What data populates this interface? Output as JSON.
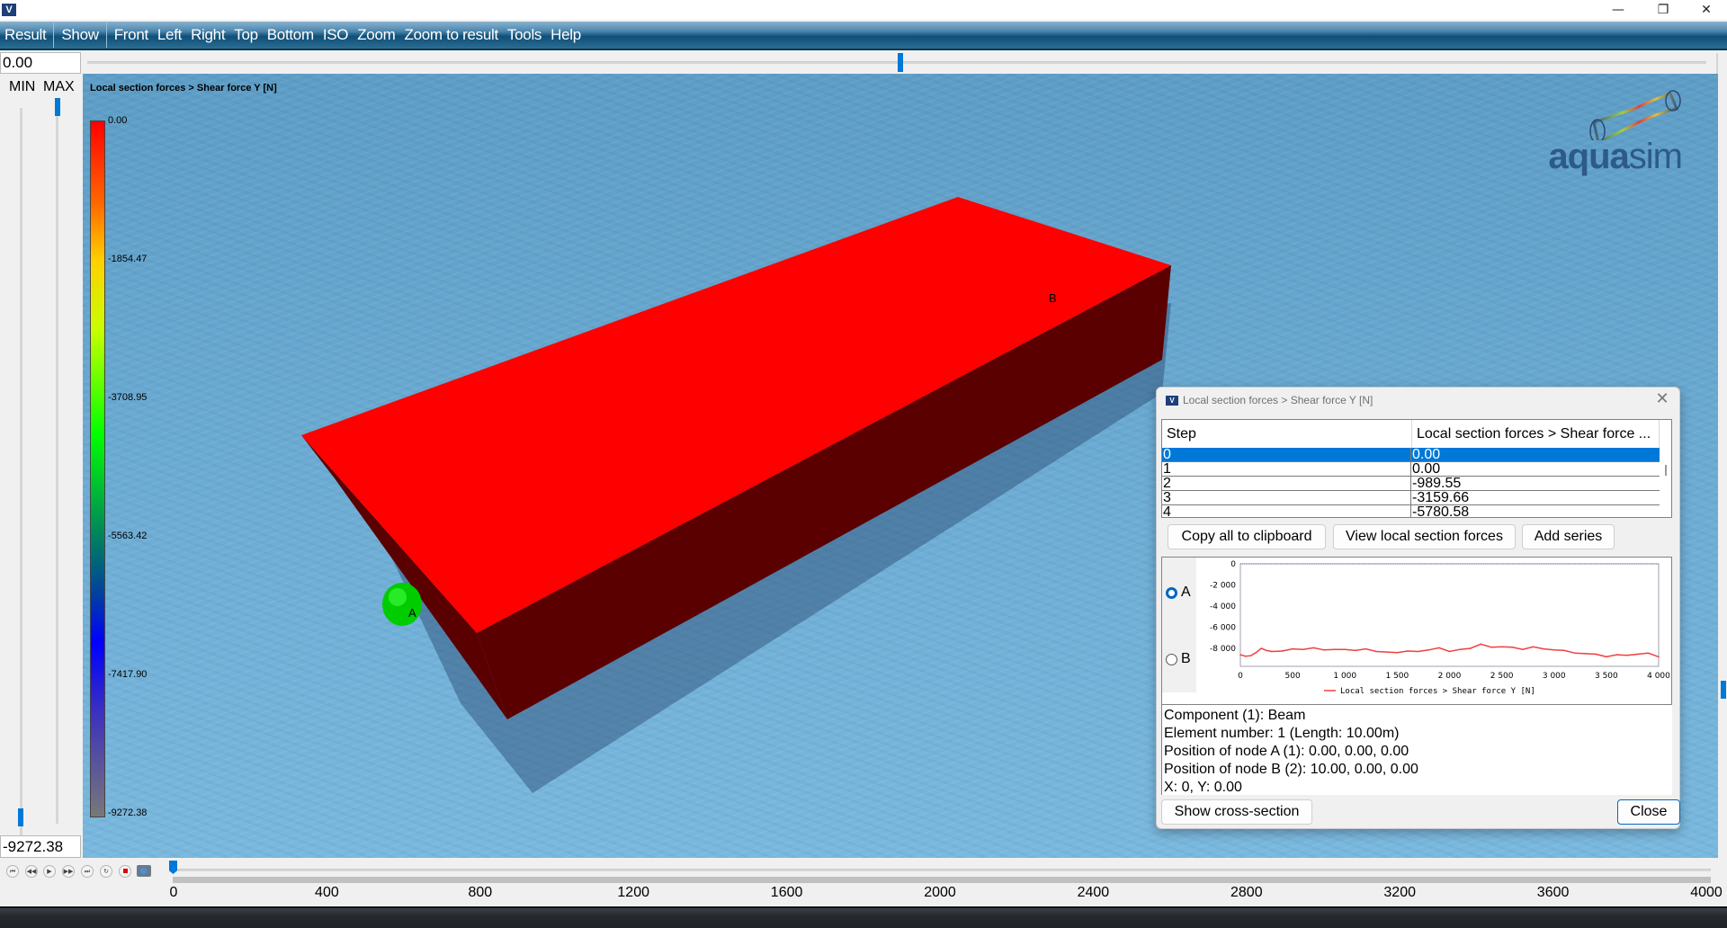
{
  "window": {
    "title": "",
    "app_icon": "aquasim-icon",
    "controls": {
      "minimize": "—",
      "restore": "❐",
      "close": "✕"
    }
  },
  "menu": [
    "Result",
    "Show",
    "Front",
    "Left",
    "Right",
    "Top",
    "Bottom",
    "ISO",
    "Zoom",
    "Zoom to result",
    "Tools",
    "Help"
  ],
  "top_slider": {
    "value": "0.00",
    "position": 0.5
  },
  "left_panel": {
    "min_label": "MIN",
    "max_label": "MAX",
    "max_value_fraction": 1.0,
    "min_value_fraction": 0.0,
    "min_value": "-9272.38"
  },
  "viewport": {
    "legend_title": "Local section forces > Shear force Y [N]",
    "legend_ticks": [
      "0.00",
      "-1854.47",
      "-3708.95",
      "-5563.42",
      "-7417.90",
      "-9272.38"
    ],
    "colors": {
      "face_top": "#ff0000",
      "face_side": "#5a0000",
      "node_sphere": "#00d000",
      "water": "#6aaad2"
    },
    "node_labels": {
      "a": "A",
      "b": "B"
    },
    "logo": {
      "bold": "aqua",
      "light": "sim"
    }
  },
  "dialog": {
    "title": "Local section forces > Shear force Y [N]",
    "close_icon": "✕",
    "table": {
      "columns": [
        "Step",
        "Local section forces > Shear force ..."
      ],
      "rows": [
        {
          "step": "0",
          "value": "0.00",
          "selected": true
        },
        {
          "step": "1",
          "value": "0.00"
        },
        {
          "step": "2",
          "value": "-989.55"
        },
        {
          "step": "3",
          "value": "-3159.66"
        },
        {
          "step": "4",
          "value": "-5780.58"
        }
      ]
    },
    "buttons": {
      "copy": "Copy all to clipboard",
      "view": "View local section forces",
      "add_series": "Add series",
      "show_cross_section": "Show cross-section",
      "close": "Close"
    },
    "radios": [
      {
        "label": "A",
        "checked": true
      },
      {
        "label": "B",
        "checked": false
      }
    ],
    "info": [
      "Component (1): Beam",
      "Element number: 1 (Length: 10.00m)",
      "Position of node A (1): 0.00, 0.00, 0.00",
      "Position of node B (2): 10.00, 0.00, 0.00",
      "X: 0, Y: 0.00"
    ]
  },
  "chart_data": {
    "type": "line",
    "title": "",
    "xlabel": "",
    "ylabel": "",
    "xlim": [
      0,
      4000
    ],
    "ylim": [
      -9700,
      0
    ],
    "x_ticks": [
      "0",
      "500",
      "1 000",
      "1 500",
      "2 000",
      "2 500",
      "3 000",
      "3 500",
      "4 000"
    ],
    "y_ticks": [
      "0",
      "-2 000",
      "-4 000",
      "-6 000",
      "-8 000"
    ],
    "legend": "top-bottom",
    "legend_entry": "Local section forces > Shear force Y [N]",
    "grid": false,
    "series": [
      {
        "name": "Local section forces > Shear force Y [N]",
        "color": "#f04040",
        "x": [
          0,
          50,
          100,
          150,
          200,
          250,
          300,
          400,
          500,
          600,
          700,
          800,
          900,
          1000,
          1100,
          1200,
          1300,
          1400,
          1500,
          1600,
          1700,
          1800,
          1900,
          2000,
          2100,
          2200,
          2300,
          2400,
          2500,
          2600,
          2700,
          2800,
          2900,
          3000,
          3100,
          3200,
          3300,
          3400,
          3500,
          3600,
          3700,
          3800,
          3900,
          4000
        ],
        "values": [
          -8600,
          -8750,
          -8700,
          -8400,
          -8000,
          -8200,
          -8300,
          -8250,
          -8050,
          -8100,
          -7950,
          -8150,
          -8100,
          -8100,
          -8200,
          -8050,
          -8300,
          -8350,
          -8400,
          -8250,
          -8300,
          -8150,
          -7950,
          -8300,
          -8100,
          -8000,
          -7600,
          -7900,
          -7850,
          -7900,
          -8100,
          -7850,
          -8050,
          -8150,
          -8200,
          -8450,
          -8500,
          -8550,
          -8800,
          -8600,
          -8650,
          -8550,
          -8450,
          -8800
        ]
      }
    ]
  },
  "timeline": {
    "ticks": [
      "0",
      "400",
      "800",
      "1200",
      "1600",
      "2000",
      "2400",
      "2800",
      "3200",
      "3600",
      "4000"
    ],
    "current": 0,
    "max": 4000,
    "controls": [
      "skip-start",
      "rewind",
      "play",
      "fast-forward",
      "skip-end",
      "loop",
      "record",
      "camera"
    ]
  }
}
